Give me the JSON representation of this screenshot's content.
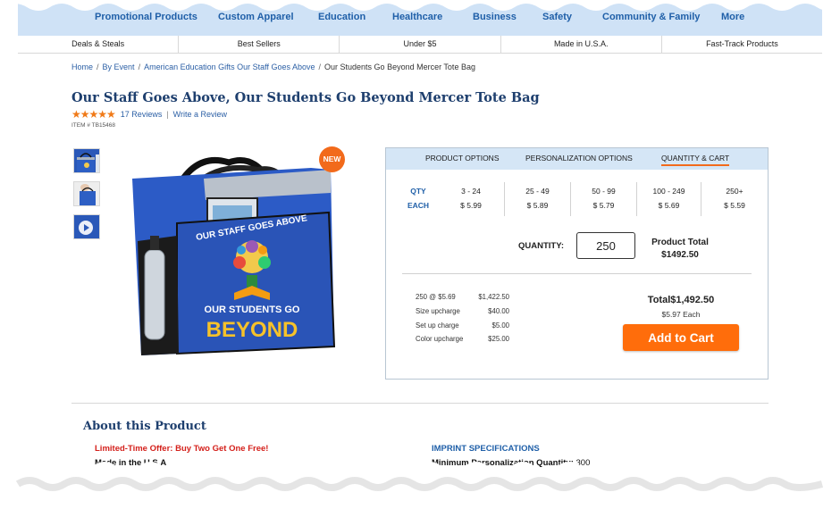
{
  "top_nav": [
    "Promotional Products",
    "Custom Apparel",
    "Education",
    "Healthcare",
    "Business",
    "Safety",
    "Community & Family",
    "More"
  ],
  "sub_nav": [
    "Deals & Steals",
    "Best Sellers",
    "Under $5",
    "Made in U.S.A.",
    "Fast-Track Products"
  ],
  "breadcrumb": {
    "items": [
      "Home",
      "By Event",
      "American Education Gifts Our Staff Goes Above"
    ],
    "current": "Our Students Go Beyond Mercer Tote Bag",
    "separator": "/"
  },
  "product": {
    "title": "Our Staff Goes Above, Our Students Go Beyond Mercer Tote Bag",
    "stars": "★★★★★",
    "rating": 5,
    "reviews": "17 Reviews",
    "write_review": "Write a Review",
    "item_number": "ITEM # TB15468",
    "badge": "NEW",
    "image_text": {
      "line1": "OUR STAFF GOES ABOVE",
      "line2": "OUR STUDENTS GO",
      "line3": "BEYOND"
    }
  },
  "panel": {
    "tabs": [
      "PRODUCT OPTIONS",
      "PERSONALIZATION OPTIONS",
      "QUANTITY & CART"
    ],
    "active_tab": "QUANTITY & CART",
    "qty_header": "QTY",
    "each_header": "EACH",
    "price_breaks": [
      {
        "qty": "3 - 24",
        "each": "$ 5.99"
      },
      {
        "qty": "25 - 49",
        "each": "$ 5.89"
      },
      {
        "qty": "50 - 99",
        "each": "$ 5.79"
      },
      {
        "qty": "100 - 249",
        "each": "$ 5.69"
      },
      {
        "qty": "250+",
        "each": "$ 5.59"
      }
    ],
    "quantity_label": "QUANTITY:",
    "quantity_value": "250",
    "product_total_label": "Product Total",
    "product_total_value": "$1492.50",
    "breakdown": [
      {
        "label": "250 @ $5.69",
        "amount": "$1,422.50"
      },
      {
        "label": "Size upcharge",
        "amount": "$40.00"
      },
      {
        "label": "Set up charge",
        "amount": "$5.00"
      },
      {
        "label": "Color upcharge",
        "amount": "$25.00"
      }
    ],
    "grand_total": "Total$1,492.50",
    "each_price": "$5.97 Each",
    "add_to_cart": "Add to Cart"
  },
  "about": {
    "title": "About this Product",
    "promo": "Limited-Time Offer: Buy Two Get One Free!",
    "made": "Made in the U.S.A",
    "imprint_heading": "IMPRINT SPECIFICATIONS",
    "min_label": "Minimum Personalization Quantity:",
    "min_value": "300"
  },
  "colors": {
    "nav_bg": "#cfe2f6",
    "link": "#2b5fa5",
    "accent_orange": "#ff6d0b",
    "title_navy": "#1e3f6e",
    "promo_red": "#d4201b"
  }
}
